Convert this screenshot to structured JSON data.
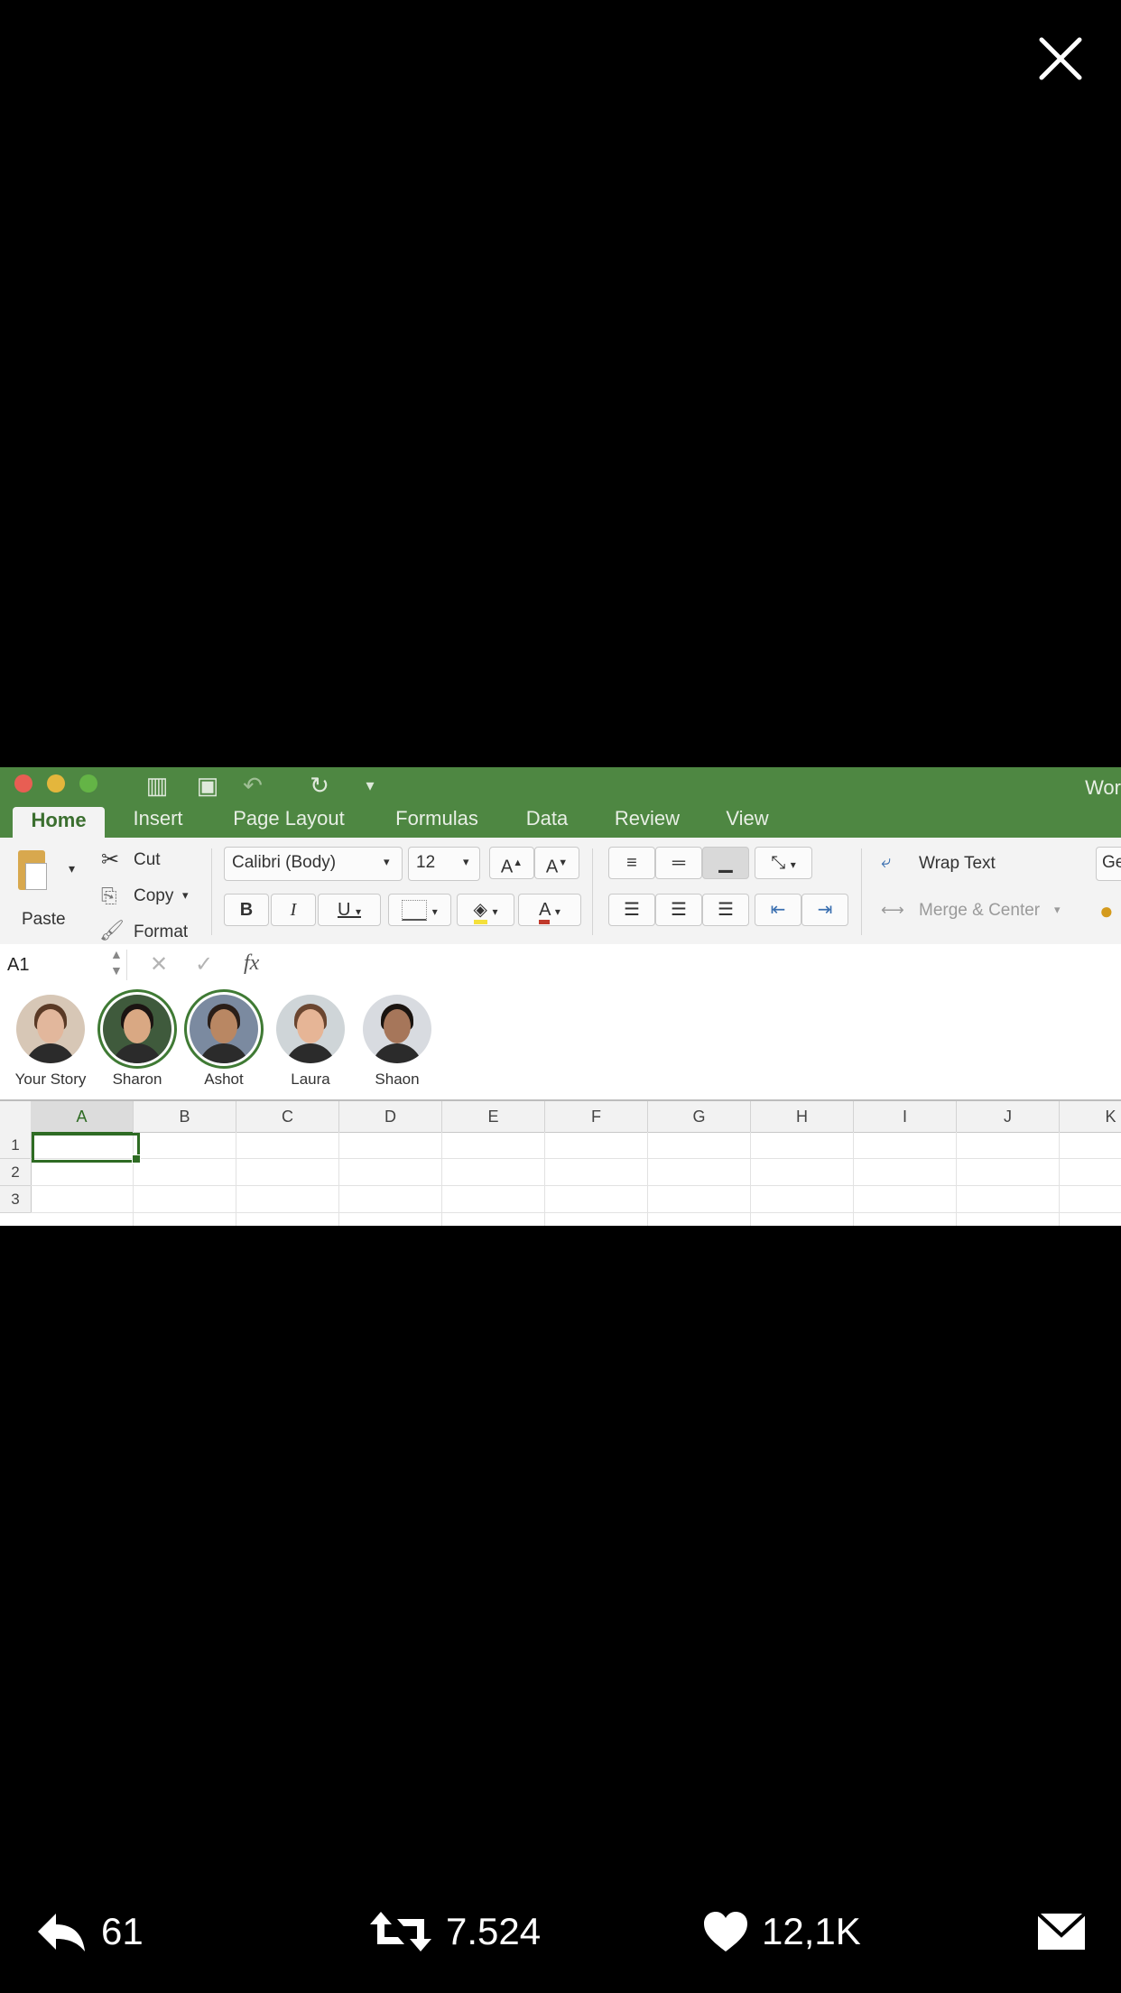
{
  "viewer": {
    "close_icon": "close-icon"
  },
  "excel": {
    "window_title_partial": "Wor",
    "tabs": [
      {
        "label": "Home",
        "active": true
      },
      {
        "label": "Insert"
      },
      {
        "label": "Page Layout"
      },
      {
        "label": "Formulas"
      },
      {
        "label": "Data"
      },
      {
        "label": "Review"
      },
      {
        "label": "View"
      }
    ],
    "clipboard": {
      "paste": "Paste",
      "cut": "Cut",
      "copy": "Copy",
      "format": "Format"
    },
    "font": {
      "name": "Calibri (Body)",
      "size": "12"
    },
    "wrap_text": "Wrap Text",
    "merge_center": "Merge & Center",
    "number_format_partial": "Ge",
    "formula_bar": {
      "name_box": "A1",
      "fx": "fx"
    },
    "stories": [
      {
        "name": "Your Story",
        "ring": false,
        "skin": "#e2b79c",
        "hair": "#5a3a26",
        "bg": "#d7c7b6"
      },
      {
        "name": "Sharon",
        "ring": true,
        "skin": "#d9a883",
        "hair": "#1b1412",
        "bg": "#3f5a3c"
      },
      {
        "name": "Ashot",
        "ring": true,
        "skin": "#b98763",
        "hair": "#2a1e18",
        "bg": "#7b8aa0"
      },
      {
        "name": "Laura",
        "ring": false,
        "skin": "#e6b596",
        "hair": "#6b4630",
        "bg": "#cfd5d8"
      },
      {
        "name": "Shaon",
        "ring": false,
        "skin": "#a6765a",
        "hair": "#1a1410",
        "bg": "#d8dbe0"
      }
    ],
    "columns": [
      "A",
      "B",
      "C",
      "D",
      "E",
      "F",
      "G",
      "H",
      "I",
      "J",
      "K"
    ],
    "rows": [
      "1",
      "2",
      "3"
    ]
  },
  "actions": {
    "reply": {
      "count": "61",
      "icon": "reply-icon"
    },
    "retweet": {
      "count": "7.524",
      "icon": "retweet-icon"
    },
    "like": {
      "count": "12,1K",
      "icon": "heart-icon"
    },
    "dm": {
      "icon": "envelope-icon"
    }
  },
  "colors": {
    "excel_green": "#4e8742",
    "selection_green": "#2e6b23"
  }
}
